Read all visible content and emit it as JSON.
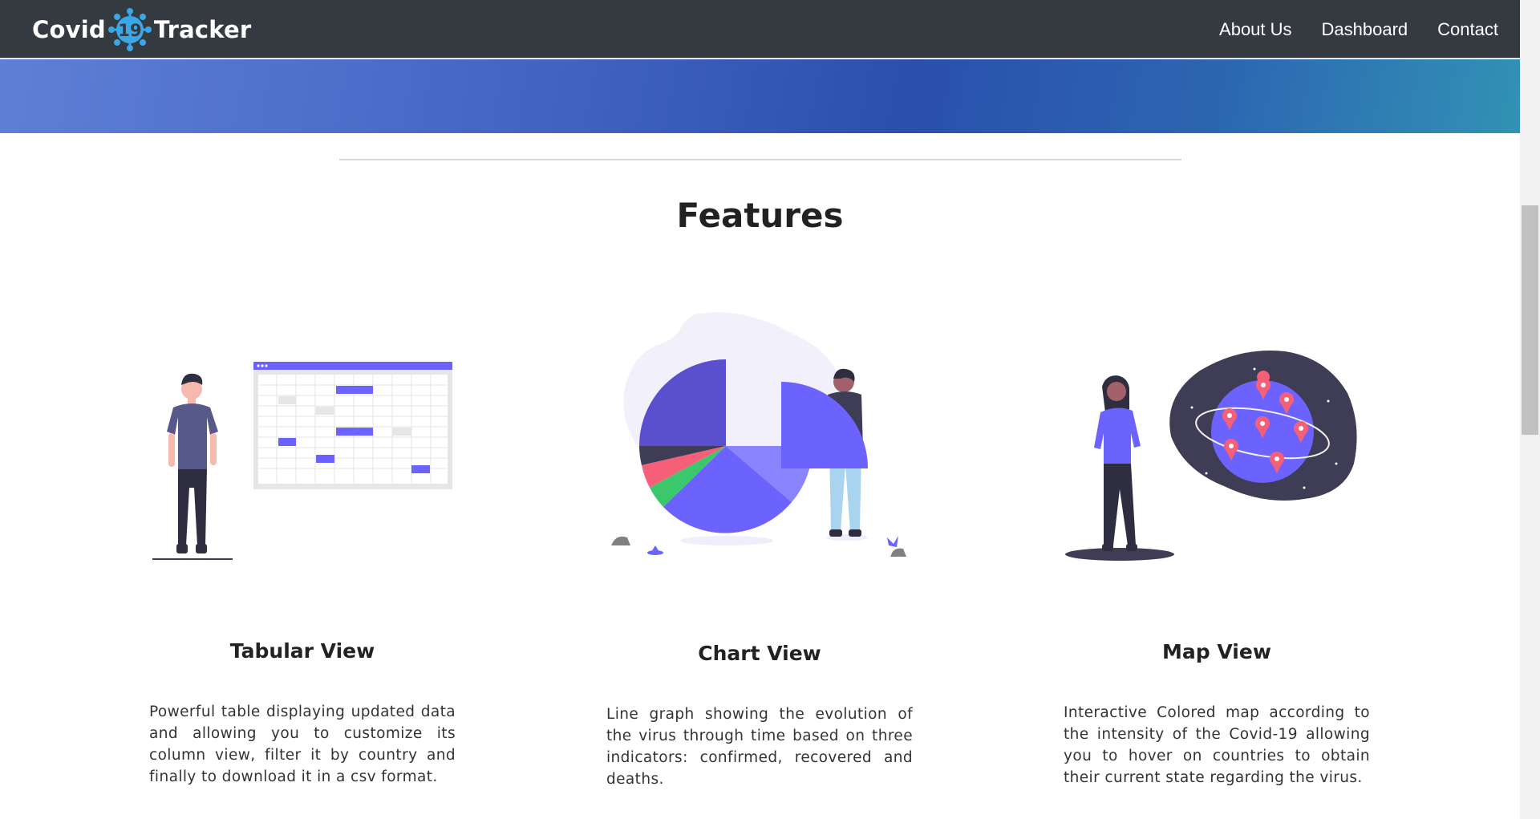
{
  "navbar": {
    "brand_left": "Covid",
    "brand_badge": "19",
    "brand_right": "Tracker",
    "links": [
      "About Us",
      "Dashboard",
      "Contact"
    ]
  },
  "features": {
    "title": "Features",
    "items": [
      {
        "title": "Tabular View",
        "description": "Powerful table displaying updated data and allowing you to customize its column view, filter it by country and finally to download it in a csv format."
      },
      {
        "title": "Chart View",
        "description": "Line graph showing the evolution of the virus through time based on three indicators: confirmed, recovered and deaths."
      },
      {
        "title": "Map View",
        "description": "Interactive Colored map according to the intensity of the Covid-19 allowing you to hover on countries to obtain their current state regarding the virus."
      }
    ]
  },
  "colors": {
    "navbar": "#343a40",
    "accent": "#6c63ff",
    "virus": "#3aa7e6",
    "pin": "#f55f77"
  }
}
